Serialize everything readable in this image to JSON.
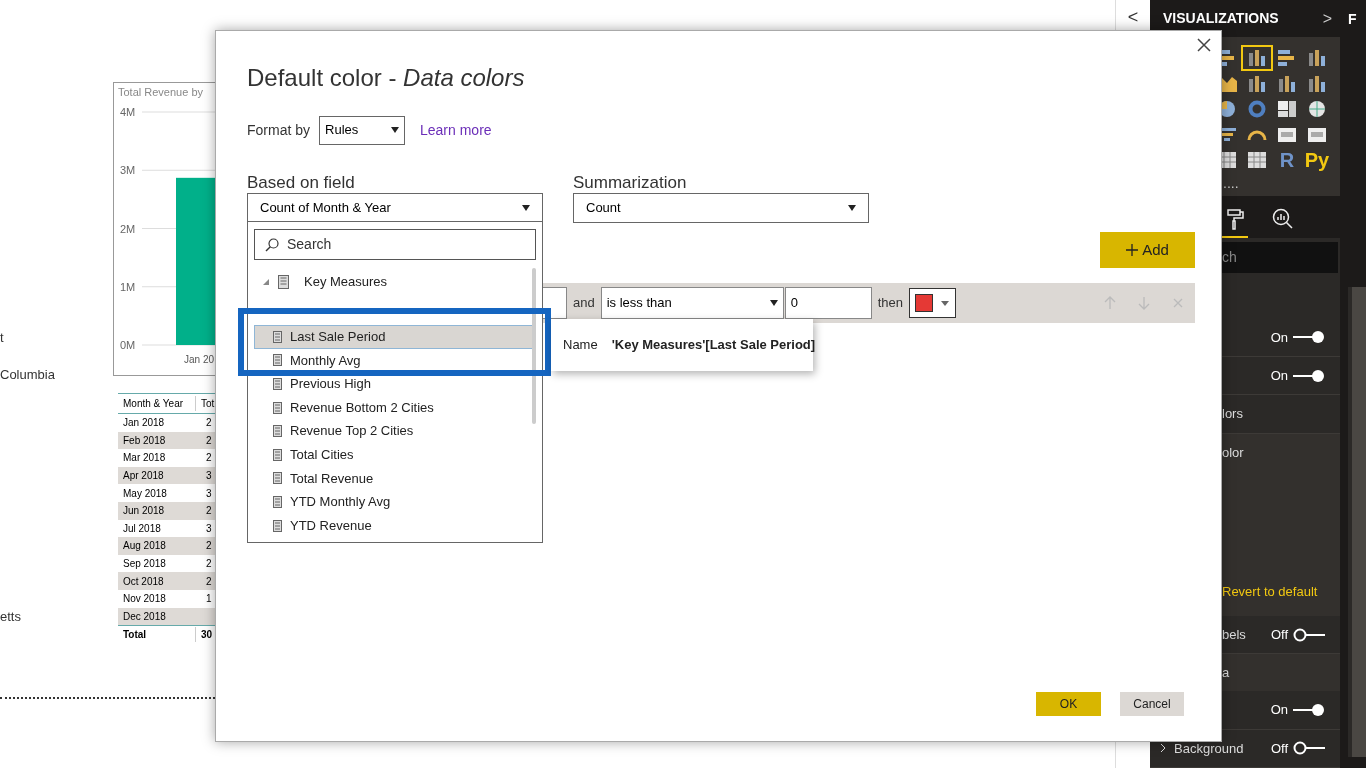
{
  "report": {
    "labels": [
      "t",
      "Columbia",
      "etts"
    ],
    "chart": {
      "chart_data": {
        "type": "bar",
        "grid": true,
        "title": "Total Revenue by",
        "categories": [
          "Jan 20"
        ],
        "values": [
          2870000
        ],
        "ylim": [
          0,
          4000000
        ],
        "yticks": [
          {
            "value": 0,
            "label": "0M"
          },
          {
            "value": 1000000,
            "label": "1M"
          },
          {
            "value": 2000000,
            "label": "2M"
          },
          {
            "value": 3000000,
            "label": "3M"
          },
          {
            "value": 4000000,
            "label": "4M"
          }
        ]
      }
    },
    "table": {
      "columns": [
        "Month & Year",
        "Tot"
      ],
      "rows": [
        [
          "Jan 2018",
          "2"
        ],
        [
          "Feb 2018",
          "2"
        ],
        [
          "Mar 2018",
          "2"
        ],
        [
          "Apr 2018",
          "3"
        ],
        [
          "May 2018",
          "3"
        ],
        [
          "Jun 2018",
          "2"
        ],
        [
          "Jul 2018",
          "3"
        ],
        [
          "Aug 2018",
          "2"
        ],
        [
          "Sep 2018",
          "2"
        ],
        [
          "Oct 2018",
          "2"
        ],
        [
          "Nov 2018",
          "1"
        ],
        [
          "Dec 2018"
        ]
      ],
      "total": [
        "Total",
        "30"
      ]
    }
  },
  "collapse_button": "<",
  "visualizations": {
    "title": "VISUALIZATIONS",
    "expand": ">",
    "visual_types": [
      {
        "kind": "bar",
        "selected": false
      },
      {
        "kind": "column",
        "selected": true
      },
      {
        "kind": "bar",
        "selected": false
      },
      {
        "kind": "column",
        "selected": false
      },
      {
        "kind": "area",
        "selected": false
      },
      {
        "kind": "column",
        "selected": false
      },
      {
        "kind": "column",
        "selected": false
      },
      {
        "kind": "column",
        "selected": false
      },
      {
        "kind": "pie",
        "selected": false
      },
      {
        "kind": "donut",
        "selected": false
      },
      {
        "kind": "treemap",
        "selected": false
      },
      {
        "kind": "globe",
        "selected": false
      },
      {
        "kind": "funnel",
        "selected": false
      },
      {
        "kind": "gauge",
        "selected": false
      },
      {
        "kind": "card",
        "selected": false
      },
      {
        "kind": "card",
        "selected": false
      },
      {
        "kind": "table",
        "selected": false
      },
      {
        "kind": "table",
        "selected": false
      },
      {
        "kind": "text",
        "label": "R",
        "selected": false
      },
      {
        "kind": "text",
        "label": "Py",
        "selected": false
      }
    ],
    "more": "....",
    "tabs": [
      {
        "kind": "format",
        "selected": true
      },
      {
        "kind": "analytics",
        "selected": false
      }
    ],
    "search_value": "ch",
    "format_rows": [
      {
        "kind": "toggle",
        "state": "On",
        "on": true
      },
      {
        "kind": "toggle",
        "state": "On",
        "on": true
      },
      {
        "kind": "section",
        "label": "lors"
      },
      {
        "kind": "label",
        "label": "olor"
      },
      {
        "kind": "link",
        "label": "Revert to default"
      },
      {
        "kind": "toggle",
        "label": "bels",
        "state": "Off",
        "on": false
      },
      {
        "kind": "label",
        "label": "a"
      },
      {
        "kind": "toggle",
        "state": "On",
        "on": true
      },
      {
        "kind": "toggle",
        "label": "Background",
        "state": "Off",
        "on": false,
        "expandable": true
      }
    ]
  },
  "fields_pane": {
    "title": "F"
  },
  "dialog": {
    "title": "Default color - *Data colors*",
    "format_by_label": "Format by",
    "format_by_value": "Rules",
    "learn_more": "Learn more",
    "based_on_label": "Based on field",
    "based_on_value": "Count of Month & Year",
    "summarization_label": "Summarization",
    "summarization_value": "Count",
    "search_placeholder": "Search",
    "group": {
      "label": "Key Measures",
      "expanded": true,
      "children": [
        {
          "label": "Last Sale Period",
          "selected": true
        },
        {
          "label": "Monthly Avg",
          "selected": false
        },
        {
          "label": "Previous High",
          "selected": false
        },
        {
          "label": "Revenue Bottom 2 Cities",
          "selected": false
        },
        {
          "label": "Revenue Top 2 Cities",
          "selected": false
        },
        {
          "label": "Total Cities",
          "selected": false
        },
        {
          "label": "Total Revenue",
          "selected": false
        },
        {
          "label": "YTD Monthly Avg",
          "selected": false
        },
        {
          "label": "YTD Revenue",
          "selected": false
        }
      ]
    },
    "tooltip": {
      "label": "Name",
      "value": "'Key Measures'[Last Sale Period]"
    },
    "add_button": "Add",
    "rule": {
      "joiner": "and",
      "operator": "is less than",
      "value": "0",
      "then": "then",
      "color": "#e53935"
    },
    "ok": "OK",
    "cancel": "Cancel"
  }
}
